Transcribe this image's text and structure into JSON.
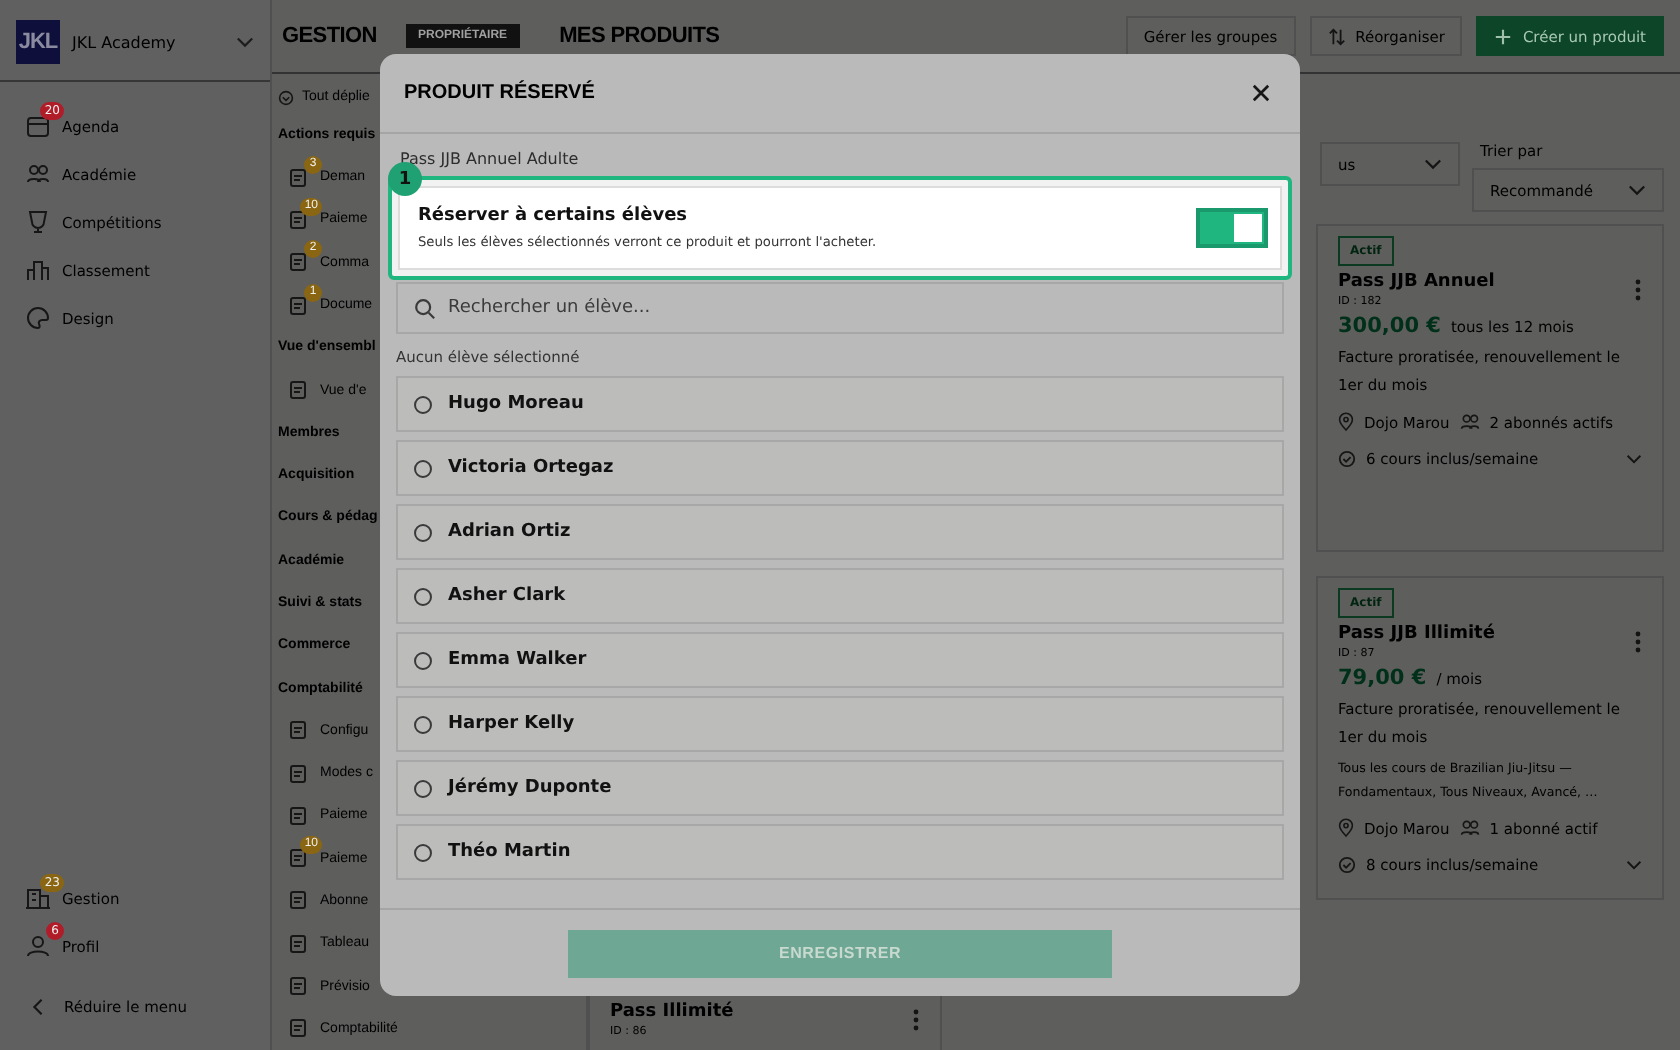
{
  "sidebar": {
    "logo": "JKL",
    "brand": "JKL Academy",
    "items": [
      {
        "label": "Agenda",
        "badge": "20",
        "color": "#b01c28"
      },
      {
        "label": "Académie"
      },
      {
        "label": "Compétitions"
      },
      {
        "label": "Classement"
      },
      {
        "label": "Design"
      }
    ],
    "bottom_items": [
      {
        "label": "Gestion",
        "badge": "23",
        "color": "#8a6612"
      },
      {
        "label": "Profil",
        "badge": "6",
        "color": "#b01c28"
      }
    ],
    "collapse": "Réduire le menu"
  },
  "subnav": {
    "expand_all": "Tout déplie",
    "sections": [
      {
        "title": "Actions requis",
        "children": [
          {
            "label": "Deman",
            "badge": "3"
          },
          {
            "label": "Paieme",
            "badge": "10"
          },
          {
            "label": "Comma",
            "badge": "2"
          },
          {
            "label": "Docume",
            "badge": "1"
          }
        ]
      },
      {
        "title": "Vue d'ensembl",
        "children": [
          {
            "label": "Vue d'e"
          }
        ]
      },
      {
        "title": "Membres"
      },
      {
        "title": "Acquisition"
      },
      {
        "title": "Cours & pédag"
      },
      {
        "title": "Académie"
      },
      {
        "title": "Suivi & stats"
      },
      {
        "title": "Commerce"
      },
      {
        "title": "Comptabilité",
        "children": [
          {
            "label": "Configu"
          },
          {
            "label": "Modes c"
          },
          {
            "label": "Paieme"
          },
          {
            "label": "Paieme",
            "badge": "10"
          },
          {
            "label": "Abonne"
          },
          {
            "label": "Tableau"
          },
          {
            "label": "Prévisio"
          },
          {
            "label": "Comptabilité"
          }
        ]
      }
    ]
  },
  "header": {
    "section": "GESTION",
    "role_badge": "PROPRIÉTAIRE",
    "page_title": "MES PRODUITS",
    "buttons": [
      {
        "label": "Gérer les groupes",
        "kind": "plain"
      },
      {
        "label": "Réorganiser",
        "kind": "sort"
      },
      {
        "label": "Créer un produit",
        "kind": "primary"
      }
    ]
  },
  "filters": {
    "sort_label": "Trier par",
    "selects": [
      "us",
      "Recommandé"
    ]
  },
  "products": [
    {
      "status": "Actif",
      "name": "Pass JJB Annuel",
      "id": "ID : 182",
      "price": "300,00 €",
      "period": "tous les 12 mois",
      "billing": "Facture proratisée, renouvellement le 1er du mois",
      "location": "Dojo Marou",
      "subscribers": "2 abonnés actifs",
      "courses": "6 cours inclus/semaine"
    },
    {
      "status": "Actif",
      "name": "Pass JJB Illimité",
      "id": "ID : 87",
      "price": "79,00 €",
      "period": "/ mois",
      "billing": "Facture proratisée, renouvellement le 1er du mois",
      "description": "Tous les cours de Brazilian Jiu-Jitsu — Fondamentaux, Tous Niveaux, Avancé, …",
      "location": "Dojo Marou",
      "subscribers": "1 abonné actif",
      "courses": "8 cours inclus/semaine"
    }
  ],
  "partial_product": {
    "name": "Pass Illimité",
    "id": "ID : 86"
  },
  "modal": {
    "title": "PRODUIT RÉSERVÉ",
    "product": "Pass JJB Annuel Adulte",
    "step": "1",
    "reserve": {
      "title": "Réserver à certains élèves",
      "description": "Seuls les élèves sélectionnés verront ce produit et pourront l'acheter.",
      "on": true
    },
    "search": {
      "placeholder": "Rechercher un élève..."
    },
    "selection_status": "Aucun élève sélectionné",
    "students": [
      {
        "name": "Hugo Moreau",
        "selected": false
      },
      {
        "name": "Victoria Ortegaz",
        "selected": false
      },
      {
        "name": "Adrian Ortiz",
        "selected": false
      },
      {
        "name": "Asher Clark",
        "selected": false
      },
      {
        "name": "Emma Walker",
        "selected": false
      },
      {
        "name": "Harper Kelly",
        "selected": false
      },
      {
        "name": "Jérémy Duponte",
        "selected": false
      },
      {
        "name": "Théo Martin",
        "selected": false
      }
    ],
    "save": "ENREGISTRER"
  }
}
